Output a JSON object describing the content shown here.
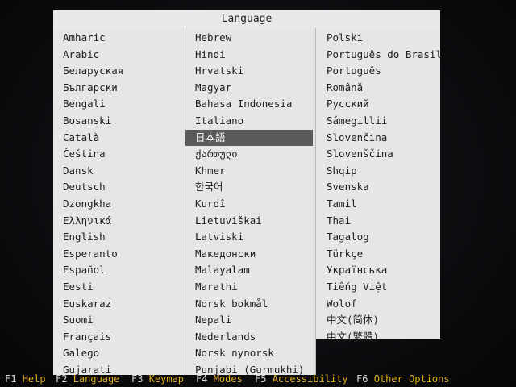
{
  "dialog": {
    "title": "Language",
    "columns": [
      [
        "Amharic",
        "Arabic",
        "Беларуская",
        "Български",
        "Bengali",
        "Bosanski",
        "Català",
        "Čeština",
        "Dansk",
        "Deutsch",
        "Dzongkha",
        "Ελληνικά",
        "English",
        "Esperanto",
        "Español",
        "Eesti",
        "Euskaraz",
        "Suomi",
        "Français",
        "Galego",
        "Gujarati"
      ],
      [
        "Hebrew",
        "Hindi",
        "Hrvatski",
        "Magyar",
        "Bahasa Indonesia",
        "Italiano",
        "日本語",
        "ქართული",
        "Khmer",
        "한국어",
        "Kurdî",
        "Lietuviškai",
        "Latviski",
        "Македонски",
        "Malayalam",
        "Marathi",
        "Norsk bokmål",
        "Nepali",
        "Nederlands",
        "Norsk nynorsk",
        "Punjabi (Gurmukhi)"
      ],
      [
        "Polski",
        "Português do Brasil",
        "Português",
        "Română",
        "Русский",
        "Sámegillii",
        "Slovenčina",
        "Slovenščina",
        "Shqip",
        "Svenska",
        "Tamil",
        "Thai",
        "Tagalog",
        "Türkçe",
        "Українська",
        "Tiếng Việt",
        "Wolof",
        "中文(简体)",
        "中文(繁體)"
      ]
    ],
    "selected": "日本語"
  },
  "function_keys": [
    {
      "key": "F1",
      "label": "Help"
    },
    {
      "key": "F2",
      "label": "Language"
    },
    {
      "key": "F3",
      "label": "Keymap"
    },
    {
      "key": "F4",
      "label": "Modes"
    },
    {
      "key": "F5",
      "label": "Accessibility"
    },
    {
      "key": "F6",
      "label": "Other Options"
    }
  ]
}
